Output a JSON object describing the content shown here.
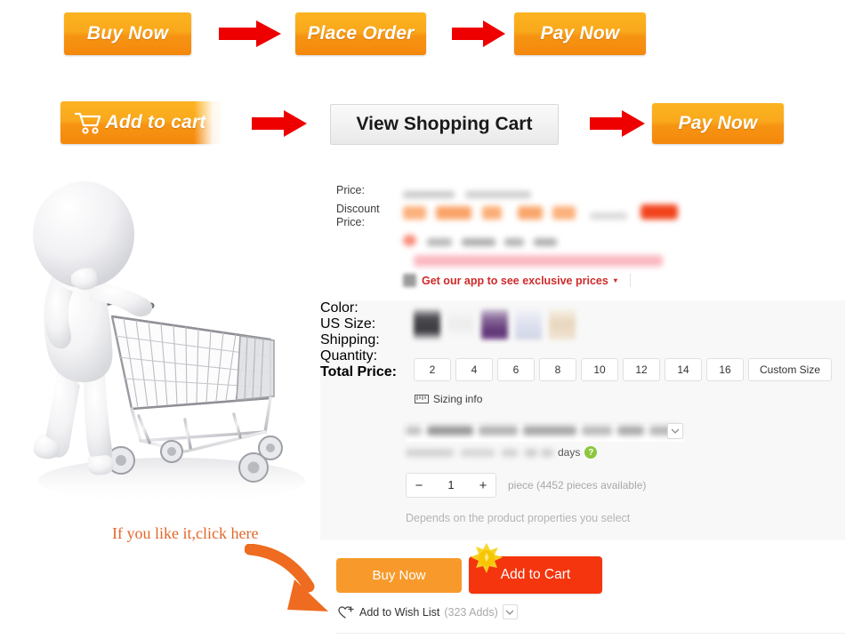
{
  "flow_row_1": {
    "steps": [
      {
        "label": "Buy Now",
        "name": "buy-now-banner-button"
      },
      {
        "label": "Place Order",
        "name": "place-order-banner-button"
      },
      {
        "label": "Pay Now",
        "name": "pay-now-banner-button"
      }
    ],
    "arrow_icon": "arrow-right-icon"
  },
  "flow_row_2": {
    "steps": [
      {
        "label": "Add to cart",
        "name": "add-to-cart-banner-button"
      },
      {
        "label": "View Shopping Cart",
        "name": "view-shopping-cart-banner-button"
      },
      {
        "label": "Pay Now",
        "name": "pay-now-banner-button-2"
      }
    ]
  },
  "illustration": {
    "alt": "3d-shopper-pushing-cart",
    "hint_text": "If you like it,click here",
    "arrow_icon": "curved-arrow-down-right-icon"
  },
  "pricing": {
    "price_label": "Price:",
    "discount_price_label": "Discount Price:",
    "app_promo": "Get our app to see exclusive prices",
    "app_promo_caret": "▾"
  },
  "product": {
    "color": {
      "label": "Color:",
      "swatches": [
        {
          "name": "color-swatch-black",
          "hex": "#4a4a4f"
        },
        {
          "name": "color-swatch-white",
          "hex": "#efefef"
        },
        {
          "name": "color-swatch-purple",
          "hex": "#6b3f82"
        },
        {
          "name": "color-swatch-lavender",
          "hex": "#d5d9ea"
        },
        {
          "name": "color-swatch-beige",
          "hex": "#e8d6bd"
        }
      ]
    },
    "size": {
      "label": "US Size:",
      "options": [
        "2",
        "4",
        "6",
        "8",
        "10",
        "12",
        "14",
        "16"
      ],
      "custom_label": "Custom Size",
      "sizing_info": "Sizing info",
      "sizing_info_icon": "ruler-icon"
    },
    "shipping": {
      "label": "Shipping:",
      "value_redacted": true,
      "estimate_suffix": "days",
      "help_icon": "question-mark-icon",
      "caret_icon": "chevron-down-icon"
    },
    "quantity": {
      "label": "Quantity:",
      "value": "1",
      "minus": "−",
      "plus": "+",
      "note": "piece (4452 pieces available)"
    },
    "total": {
      "label": "Total Price:",
      "note": "Depends on the product properties you select"
    }
  },
  "actions": {
    "buy_now": "Buy Now",
    "add_to_cart": "Add to Cart",
    "coin_icon": "gold-coin-icon",
    "wishlist_label": "Add to Wish List",
    "wishlist_count": "(323 Adds)",
    "wishlist_icon": "heart-plus-icon",
    "wishlist_caret": "▾"
  },
  "colors": {
    "orange_button": "#f9a81b",
    "red_arrow": "#ee0000",
    "cart_red": "#f4350e",
    "buy_orange": "#f79a2b",
    "promo_red": "#cf2a2a",
    "hint_orange": "#e2672a",
    "panel_bg": "#f8f8f8"
  }
}
